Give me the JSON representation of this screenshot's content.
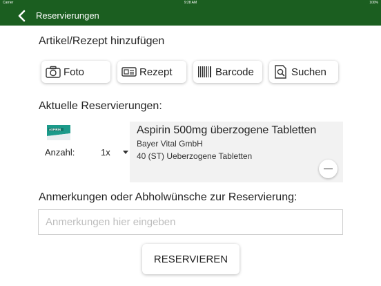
{
  "status_bar": {
    "carrier": "Carrier",
    "time": "9:28 AM",
    "battery": "100%"
  },
  "nav": {
    "title": "Reservierungen"
  },
  "add_section": {
    "title": "Artikel/Rezept hinzufügen",
    "buttons": {
      "photo": "Foto",
      "prescription": "Rezept",
      "barcode": "Barcode",
      "search": "Suchen"
    }
  },
  "current_section": {
    "title": "Aktuelle Reservierungen:"
  },
  "reservation": {
    "quantity_label": "Anzahl:",
    "quantity": "1x",
    "product_name": "Aspirin 500mg überzogene Tabletten",
    "manufacturer": "Bayer Vital GmbH",
    "package": "40 (ST) Ueberzogene Tabletten",
    "pack_brand": "ASPIRIN"
  },
  "notes_section": {
    "title": "Anmerkungen oder Abholwünsche zur Reservierung:",
    "placeholder": "Anmerkungen hier eingeben",
    "value": ""
  },
  "submit": {
    "label": "RESERVIEREN"
  },
  "colors": {
    "nav_green": "#1b5e20",
    "pack_teal": "#1b9a8a",
    "row_bg": "#f2f2f2"
  }
}
